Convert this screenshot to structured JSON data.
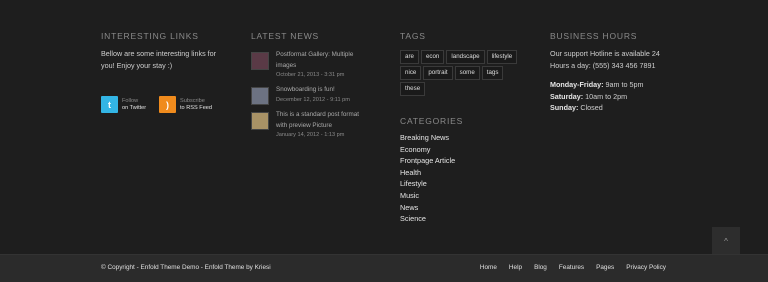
{
  "links": {
    "title": "INTERESTING LINKS",
    "text": "Bellow are some interesting links for you! Enjoy your stay :)",
    "twitter": {
      "top": "Follow",
      "bottom": "on Twitter"
    },
    "rss": {
      "top": "Subscribe",
      "bottom": "to RSS Feed"
    }
  },
  "news": {
    "title": "LATEST NEWS",
    "items": [
      {
        "title": "Postformat Gallery: Multiple images",
        "date": "October 21, 2013 - 3:31 pm",
        "thumb_color": "#5a3a46"
      },
      {
        "title": "Snowboarding is fun!",
        "date": "December 12, 2012 - 9:11 pm",
        "thumb_color": "#6c7282"
      },
      {
        "title": "This is a standard post format with preview Picture",
        "date": "January 14, 2012 - 1:13 pm",
        "thumb_color": "#a89266"
      }
    ]
  },
  "tags": {
    "title": "TAGS",
    "items": [
      "are",
      "econ",
      "landscape",
      "lifestyle",
      "nice",
      "portrait",
      "some",
      "tags",
      "these"
    ]
  },
  "categories": {
    "title": "CATEGORIES",
    "items": [
      "Breaking News",
      "Economy",
      "Frontpage Article",
      "Health",
      "Lifestyle",
      "Music",
      "News",
      "Science"
    ]
  },
  "hours": {
    "title": "BUSINESS HOURS",
    "text": "Our support Hotline is available 24 Hours a day: (555) 343 456 7891",
    "rows": [
      {
        "day": "Monday-Friday:",
        "time": " 9am to 5pm"
      },
      {
        "day": "Saturday:",
        "time": " 10am to 2pm"
      },
      {
        "day": "Sunday:",
        "time": " Closed"
      }
    ]
  },
  "scroll_top": {
    "icon": "chevron-up-icon",
    "glyph": "^"
  },
  "socket": {
    "copyright": "© Copyright - Enfold Theme Demo - Enfold Theme by Kriesi",
    "nav": [
      "Home",
      "Help",
      "Blog",
      "Features",
      "Pages",
      "Privacy Policy"
    ]
  }
}
